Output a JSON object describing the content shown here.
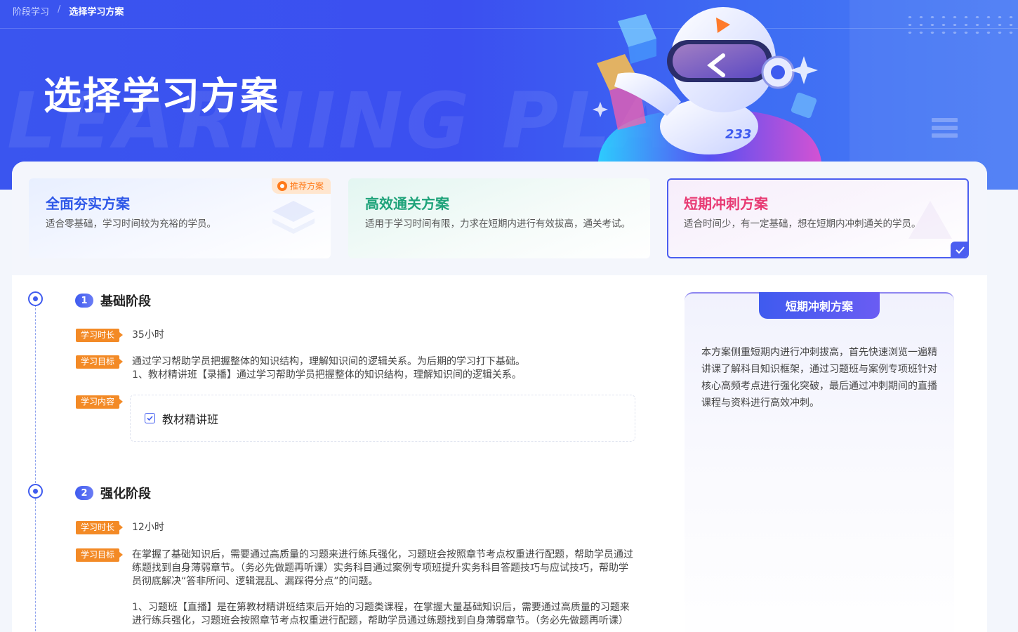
{
  "breadcrumb": {
    "parent": "阶段学习",
    "separator": "/",
    "current": "选择学习方案"
  },
  "hero": {
    "title": "选择学习方案",
    "watermark": "LEARNING PLAN",
    "mascot_label": "233"
  },
  "plans": [
    {
      "title": "全面夯实方案",
      "desc": "适合零基础，学习时间较为充裕的学员。",
      "badge": "推荐方案"
    },
    {
      "title": "高效通关方案",
      "desc": "适用于学习时间有限，力求在短期内进行有效拔高，通关考试。"
    },
    {
      "title": "短期冲刺方案",
      "desc": "适合时间少，有一定基础，想在短期内冲刺通关的学员。"
    }
  ],
  "stages": [
    {
      "num": "1",
      "title": "基础阶段",
      "duration_tag": "学习时长",
      "duration": "35小时",
      "goal_tag": "学习目标",
      "goal": "通过学习帮助学员把握整体的知识结构，理解知识间的逻辑关系。为后期的学习打下基础。",
      "goal_detail": "1、教材精讲班【录播】通过学习帮助学员把握整体的知识结构，理解知识间的逻辑关系。",
      "content_tag": "学习内容",
      "content_item": "教材精讲班"
    },
    {
      "num": "2",
      "title": "强化阶段",
      "duration_tag": "学习时长",
      "duration": "12小时",
      "goal_tag": "学习目标",
      "goal": "在掌握了基础知识后，需要通过高质量的习题来进行练兵强化，习题班会按照章节考点权重进行配题，帮助学员通过练题找到自身薄弱章节。（务必先做题再听课）实务科目通过案例专项班提升实务科目答题技巧与应试技巧，帮助学员彻底解决“答非所问、逻辑混乱、漏踩得分点”的问题。",
      "goal_detail": "1、习题班【直播】是在第教材精讲班结束后开始的习题类课程，在掌握大量基础知识后，需要通过高质量的习题来进行练兵强化，习题班会按照章节考点权重进行配题，帮助学员通过练题找到自身薄弱章节。（务必先做题再听课）"
    }
  ],
  "side": {
    "tab": "短期冲刺方案",
    "text": "本方案侧重短期内进行冲刺拔高，首先快速浏览一遍精讲课了解科目知识框架，通过习题班与案例专项班针对核心高频考点进行强化突破，最后通过冲刺期间的直播课程与资料进行高效冲刺。"
  },
  "colors": {
    "primary": "#3f5bef",
    "accent_orange": "#f38a26",
    "plan1": "#2f58e8",
    "plan2": "#1fa37a",
    "plan3": "#e83a73"
  }
}
